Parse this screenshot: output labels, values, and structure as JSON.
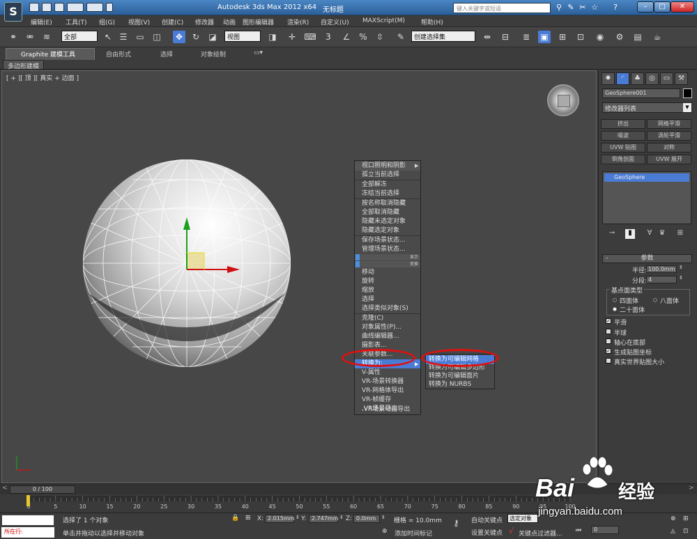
{
  "title": {
    "app": "Autodesk 3ds Max  2012 x64",
    "doc": "无标题",
    "search_placeholder": "键入关键字或短语"
  },
  "menu": [
    "编辑(E)",
    "工具(T)",
    "组(G)",
    "视图(V)",
    "创建(C)",
    "修改器",
    "动画",
    "图形编辑器",
    "渲染(R)",
    "自定义(U)",
    "MAXScript(M)",
    "帮助(H)"
  ],
  "toolbar": {
    "filter": "全部",
    "ref_coord": "视图",
    "named_sel": "创建选择集"
  },
  "ribbon": {
    "tabs": [
      "Graphite 建模工具",
      "自由形式",
      "选择",
      "对象绘制"
    ],
    "sub": "多边形建模"
  },
  "viewport": {
    "label": "[ + ][ 顶 ][ 真实 + 边面 ]"
  },
  "context_menu": {
    "items": [
      "视口照明和阴影",
      "孤立当前选择",
      "全部解冻",
      "冻结当前选择",
      "按名称取消隐藏",
      "全部取消隐藏",
      "隐藏未选定对象",
      "隐藏选定对象",
      "保存场景状态...",
      "管理场景状态...",
      "移动",
      "旋转",
      "缩放",
      "选择",
      "选择类似对象(S)",
      "克隆(C)",
      "对象属性(P)...",
      "曲线编辑器...",
      "摄影表...",
      "关联参数...",
      "转换为:",
      "V-属性",
      "VR-场景转换器",
      "VR-网格体导出",
      "VR-帧缓存",
      ".VR场景导出",
      ".VR场景动画导出"
    ],
    "headers": [
      "显示",
      "变换"
    ],
    "submenu": [
      "转换为可编辑网格",
      "转换为可编辑多边形",
      "转换为可编辑面片",
      "转换为 NURBS"
    ]
  },
  "panel": {
    "object_name": "GeoSphere001",
    "modifier_list": "修改器列表",
    "mod_buttons": [
      "挤出",
      "网格平滑",
      "噪波",
      "涡轮平滑",
      "UVW 贴图",
      "对称",
      "倒角剖面",
      "UVW 展开"
    ],
    "stack_item": "GeoSphere",
    "rollout": "参数",
    "radius_label": "半径:",
    "radius": "100.0mm",
    "segments_label": "分段:",
    "segments": "4",
    "base_type_label": "基点面类型",
    "base_types": [
      "四面体",
      "八面体",
      "二十面体"
    ],
    "checkboxes": [
      {
        "label": "平滑",
        "checked": true
      },
      {
        "label": "半球",
        "checked": false
      },
      {
        "label": "轴心在底部",
        "checked": false
      },
      {
        "label": "生成贴图坐标",
        "checked": true
      },
      {
        "label": "真实世界贴图大小",
        "checked": false
      }
    ]
  },
  "timeline": {
    "slider": "0 / 100",
    "ticks": [
      "0",
      "5",
      "10",
      "15",
      "20",
      "25",
      "30",
      "35",
      "40",
      "45",
      "50",
      "55",
      "60",
      "65",
      "70",
      "75",
      "80",
      "85",
      "90",
      "95",
      "100"
    ]
  },
  "status": {
    "selected": "选择了 1 个对象",
    "prompt": "单击并拖动以选择并移动对象",
    "running": "所在行:",
    "x_label": "X:",
    "x": "2.015mm",
    "y_label": "Y:",
    "y": "2.747mm",
    "z_label": "Z:",
    "z": "0.0mm",
    "grid": "栅格 = 10.0mm",
    "add_tag": "添加时间标记",
    "autokey": "自动关键点",
    "setkey": "设置关键点",
    "selset": "选定对象",
    "keyfilter": "关键点过滤器...",
    "frame": "0"
  },
  "watermark": {
    "brand_latin": "Bai",
    "brand_cn": "经验",
    "url": "jingyan.baidu.com"
  },
  "colors": {
    "accent": "#4a7cd6",
    "highlight_ring": "#e01010",
    "title_bar": "#2c5f99"
  }
}
